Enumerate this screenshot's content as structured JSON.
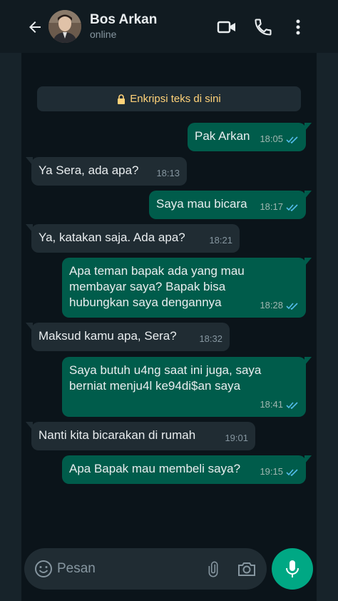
{
  "header": {
    "contact_name": "Bos Arkan",
    "status": "online",
    "icons": [
      "back-arrow-icon",
      "video-call-icon",
      "voice-call-icon",
      "more-options-icon"
    ]
  },
  "encryption_notice": "Enkripsi teks di sini",
  "messages": [
    {
      "direction": "out",
      "text": "Pak Arkan",
      "time": "18:05"
    },
    {
      "direction": "in",
      "text": "Ya Sera, ada apa?",
      "time": "18:13"
    },
    {
      "direction": "out",
      "text": "Saya mau bicara",
      "time": "18:17"
    },
    {
      "direction": "in",
      "text": "Ya, katakan saja. Ada apa?",
      "time": "18:21"
    },
    {
      "direction": "out",
      "text": "Apa teman bapak ada yang mau\nmembayar saya? Bapak bisa\nhubungkan saya dengannya",
      "time": "18:28"
    },
    {
      "direction": "in",
      "text": "Maksud kamu apa, Sera?",
      "time": "18:32"
    },
    {
      "direction": "out",
      "text": "Saya butuh u4ng saat ini juga, saya\nberniat menju4l ke94di$an saya",
      "time": "18:41"
    },
    {
      "direction": "in",
      "text": "Nanti kita bicarakan di rumah",
      "time": "19:01"
    },
    {
      "direction": "out",
      "text": "Apa Bapak mau membeli saya?",
      "time": "19:15"
    }
  ],
  "composer": {
    "placeholder": "Pesan",
    "icons": [
      "emoji-icon",
      "attach-icon",
      "camera-icon",
      "mic-icon"
    ]
  },
  "colors": {
    "background": "#0b141a",
    "incoming_bubble": "#202c33",
    "outgoing_bubble": "#005c4b",
    "accent": "#00a884",
    "read_tick": "#53bdeb"
  }
}
